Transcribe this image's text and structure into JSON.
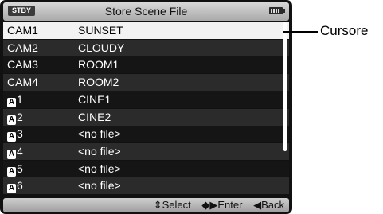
{
  "header": {
    "status": "STBY",
    "title": "Store Scene File",
    "battery_icon": "battery-icon"
  },
  "list": {
    "items": [
      {
        "badge": "",
        "name": "CAM1",
        "value": "SUNSET",
        "selected": true
      },
      {
        "badge": "",
        "name": "CAM2",
        "value": "CLOUDY"
      },
      {
        "badge": "",
        "name": "CAM3",
        "value": "ROOM1"
      },
      {
        "badge": "",
        "name": "CAM4",
        "value": "ROOM2"
      },
      {
        "badge": "A",
        "name": "1",
        "value": "CINE1"
      },
      {
        "badge": "A",
        "name": "2",
        "value": "CINE2"
      },
      {
        "badge": "A",
        "name": "3",
        "value": "<no file>"
      },
      {
        "badge": "A",
        "name": "4",
        "value": "<no file>"
      },
      {
        "badge": "A",
        "name": "5",
        "value": "<no file>"
      },
      {
        "badge": "A",
        "name": "6",
        "value": "<no file>"
      }
    ]
  },
  "footer": {
    "select": "⇕Select",
    "enter": "◆▶Enter",
    "back": "◀Back"
  },
  "annotation": {
    "label": "Cursore"
  }
}
